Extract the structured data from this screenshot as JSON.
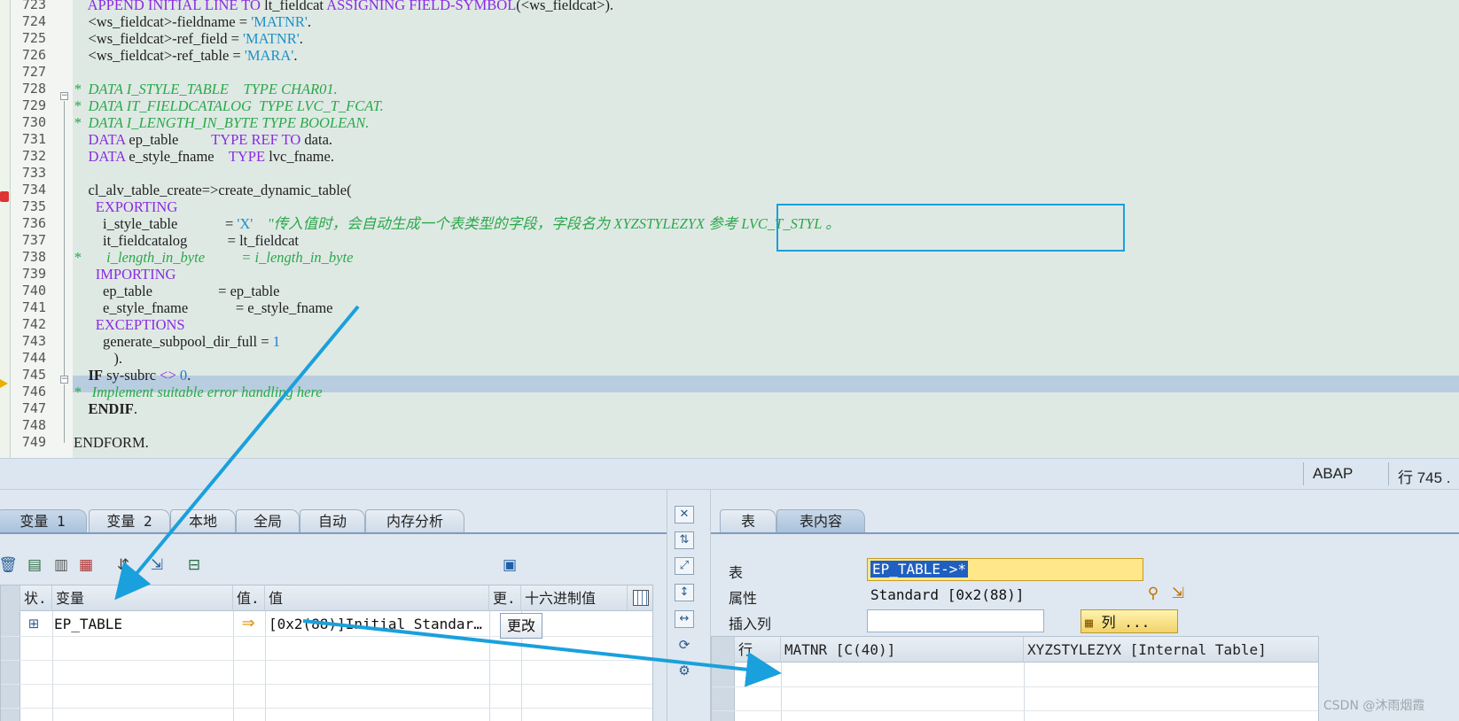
{
  "editor": {
    "lines": [
      {
        "num": "723",
        "html": "    <span class=\"kw\">APPEND INITIAL LINE TO</span> lt_fieldcat <span class=\"kw\">ASSIGNING FIELD-SYMBOL</span>(&lt;ws_fieldcat&gt;)."
      },
      {
        "num": "724",
        "html": "    &lt;ws_fieldcat&gt;-fieldname = <span class=\"str\">'MATNR'</span>."
      },
      {
        "num": "725",
        "html": "    &lt;ws_fieldcat&gt;-ref_field = <span class=\"str\">'MATNR'</span>."
      },
      {
        "num": "726",
        "html": "    &lt;ws_fieldcat&gt;-ref_table = <span class=\"str\">'MARA'</span>."
      },
      {
        "num": "727",
        "html": ""
      },
      {
        "num": "728",
        "html": "<span class=\"com\">*  DATA I_STYLE_TABLE    TYPE CHAR01.</span>"
      },
      {
        "num": "729",
        "html": "<span class=\"com\">*  DATA IT_FIELDCATALOG  TYPE LVC_T_FCAT.</span>"
      },
      {
        "num": "730",
        "html": "<span class=\"com\">*  DATA I_LENGTH_IN_BYTE TYPE BOOLEAN.</span>"
      },
      {
        "num": "731",
        "html": "    <span class=\"kw\">DATA</span> ep_table         <span class=\"kw\">TYPE REF TO</span> data."
      },
      {
        "num": "732",
        "html": "    <span class=\"kw\">DATA</span> e_style_fname    <span class=\"kw\">TYPE</span> lvc_fname."
      },
      {
        "num": "733",
        "html": ""
      },
      {
        "num": "734",
        "html": "    cl_alv_table_create=&gt;create_dynamic_table("
      },
      {
        "num": "735",
        "html": "      <span class=\"kw\">EXPORTING</span>"
      },
      {
        "num": "736",
        "html": "        i_style_table             = <span class=\"str\">'X'</span>    <span class=\"com\">\"传入值时，会自动生成一个表类型的字段，字段名为 XYZSTYLEZYX 参考 LVC_T_STYL 。</span>"
      },
      {
        "num": "737",
        "html": "        it_fieldcatalog           = lt_fieldcat"
      },
      {
        "num": "738",
        "html": "<span class=\"com\">*       i_length_in_byte          = i_length_in_byte</span>"
      },
      {
        "num": "739",
        "html": "      <span class=\"kw\">IMPORTING</span>"
      },
      {
        "num": "740",
        "html": "        ep_table                  = ep_table"
      },
      {
        "num": "741",
        "html": "        e_style_fname             = e_style_fname"
      },
      {
        "num": "742",
        "html": "      <span class=\"kw\">EXCEPTIONS</span>"
      },
      {
        "num": "743",
        "html": "        generate_subpool_dir_full = <span class=\"num\">1</span>"
      },
      {
        "num": "744",
        "html": "           )."
      },
      {
        "num": "745",
        "html": "    <span class=\"bold\">IF</span> sy-subrc <span class=\"kw\">&lt;&gt;</span> <span class=\"num\">0</span>."
      },
      {
        "num": "746",
        "html": "<span class=\"com\">*   Implement suitable error handling here</span>"
      },
      {
        "num": "747",
        "html": "    <span class=\"bold\">ENDIF</span>."
      },
      {
        "num": "748",
        "html": ""
      },
      {
        "num": "749",
        "html": "ENDFORM."
      }
    ]
  },
  "statusbar": {
    "language": "ABAP",
    "row_label": "行 745 ."
  },
  "left_panel": {
    "tabs": [
      "变量 1",
      "变量 2",
      "本地",
      "全局",
      "自动",
      "内存分析"
    ],
    "grid": {
      "columns": [
        "状.",
        "变量",
        "值.",
        "值",
        "更.",
        "十六进制值"
      ],
      "rows": [
        {
          "variable": "EP_TABLE",
          "value": "[0x2(88)]Initial Standar…",
          "change_button": "更改"
        }
      ]
    }
  },
  "right_panel": {
    "tabs": [
      "表",
      "表内容"
    ],
    "table_label": "表",
    "table_value": "EP_TABLE->*",
    "attr_label": "属性",
    "attr_value": "Standard [0x2(88)]",
    "insert_col_label": "插入列",
    "col_button": "列 ...",
    "grid": {
      "columns": [
        "行",
        "MATNR [C(40)]",
        "XYZSTYLEZYX [Internal Table]"
      ]
    }
  },
  "watermark": "CSDN @沐雨烟霞",
  "colors": {
    "annotation": "#1aa0dc",
    "keyword": "#8a2be2",
    "comment": "#2aa84a",
    "string": "#1e90c8"
  }
}
